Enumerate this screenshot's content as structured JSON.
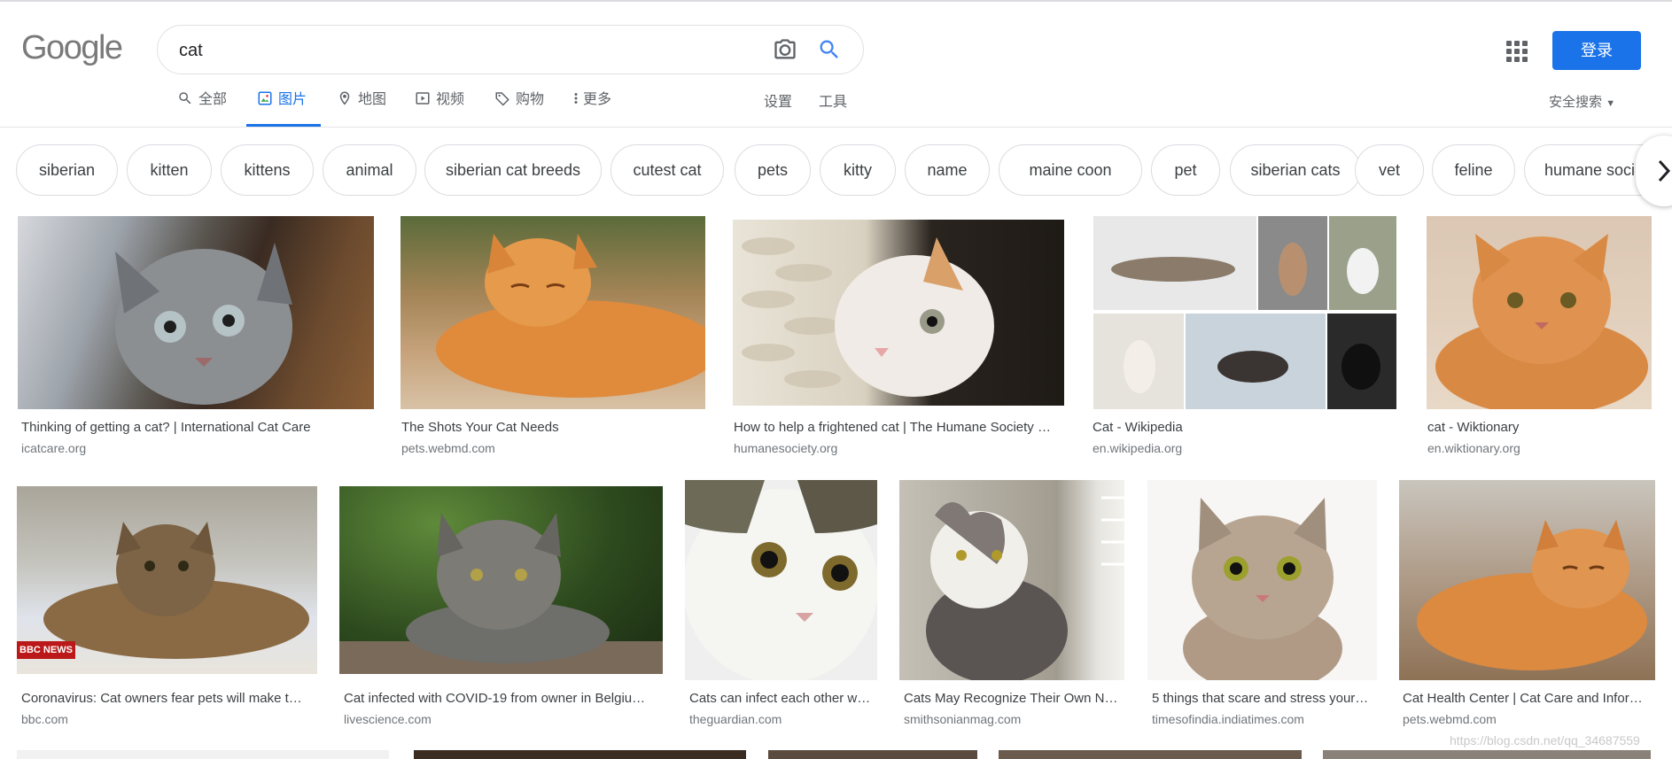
{
  "search": {
    "query": "cat"
  },
  "tabs": [
    "全部",
    "图片",
    "地图",
    "视频",
    "购物",
    "更多"
  ],
  "tools": {
    "settings": "设置",
    "tools": "工具"
  },
  "login": "登录",
  "safe_search": "安全搜索",
  "chips": [
    "siberian",
    "kitten",
    "kittens",
    "animal",
    "siberian cat breeds",
    "cutest cat",
    "pets",
    "kitty",
    "name",
    "maine coon",
    "pet",
    "siberian cats",
    "vet",
    "feline",
    "humane soci"
  ],
  "results": [
    {
      "caption": "Thinking of getting a cat? | International Cat Care",
      "source": "icatcare.org"
    },
    {
      "caption": "The Shots Your Cat Needs",
      "source": "pets.webmd.com"
    },
    {
      "caption": "How to help a frightened cat | The Humane Society …",
      "source": "humanesociety.org"
    },
    {
      "caption": "Cat - Wikipedia",
      "source": "en.wikipedia.org"
    },
    {
      "caption": "cat - Wiktionary",
      "source": "en.wiktionary.org"
    },
    {
      "caption": "Coronavirus: Cat owners fear pets will make t…",
      "source": "bbc.com",
      "badge": "BBC NEWS"
    },
    {
      "caption": "Cat infected with COVID-19 from owner in Belgiu…",
      "source": "livescience.com"
    },
    {
      "caption": "Cats can infect each other w…",
      "source": "theguardian.com"
    },
    {
      "caption": "Cats May Recognize Their Own N…",
      "source": "smithsonianmag.com"
    },
    {
      "caption": "5 things that scare and stress your…",
      "source": "timesofindia.indiatimes.com"
    },
    {
      "caption": "Cat Health Center | Cat Care and Infor…",
      "source": "pets.webmd.com"
    }
  ],
  "watermark": "https://blog.csdn.net/qq_34687559"
}
